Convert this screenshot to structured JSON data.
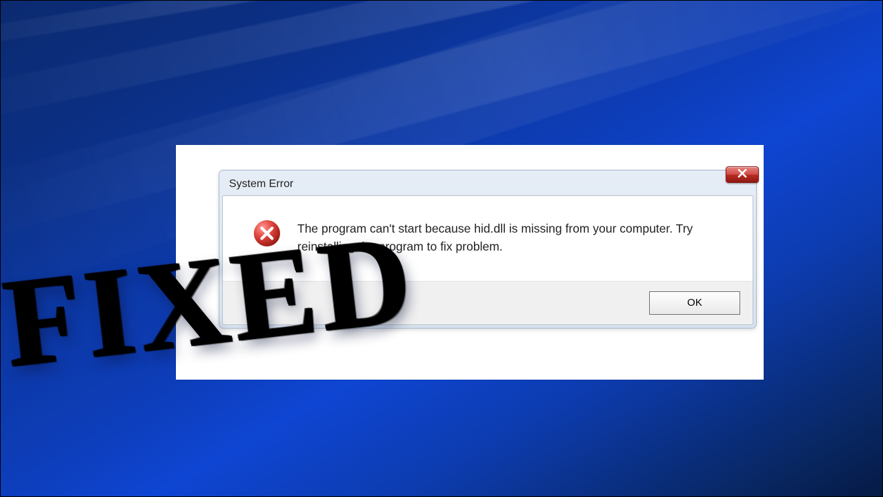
{
  "dialog": {
    "title": "System Error",
    "message": "The program can't start because hid.dll is missing from your computer. Try reinstalling the program to fix problem.",
    "ok_label": "OK"
  },
  "overlay": {
    "fixed_text": "FIXED"
  }
}
